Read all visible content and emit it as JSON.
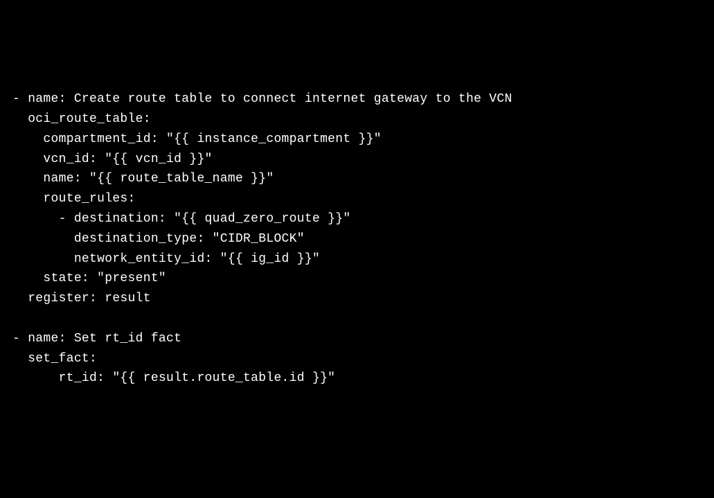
{
  "code": {
    "line1": "- name: Create route table to connect internet gateway to the VCN",
    "line2": "  oci_route_table:",
    "line3": "    compartment_id: \"{{ instance_compartment }}\"",
    "line4": "    vcn_id: \"{{ vcn_id }}\"",
    "line5": "    name: \"{{ route_table_name }}\"",
    "line6": "    route_rules:",
    "line7": "      - destination: \"{{ quad_zero_route }}\"",
    "line8": "        destination_type: \"CIDR_BLOCK\"",
    "line9": "        network_entity_id: \"{{ ig_id }}\"",
    "line10": "    state: \"present\"",
    "line11": "  register: result",
    "line12": "",
    "line13": "- name: Set rt_id fact",
    "line14": "  set_fact:",
    "line15": "      rt_id: \"{{ result.route_table.id }}\""
  }
}
